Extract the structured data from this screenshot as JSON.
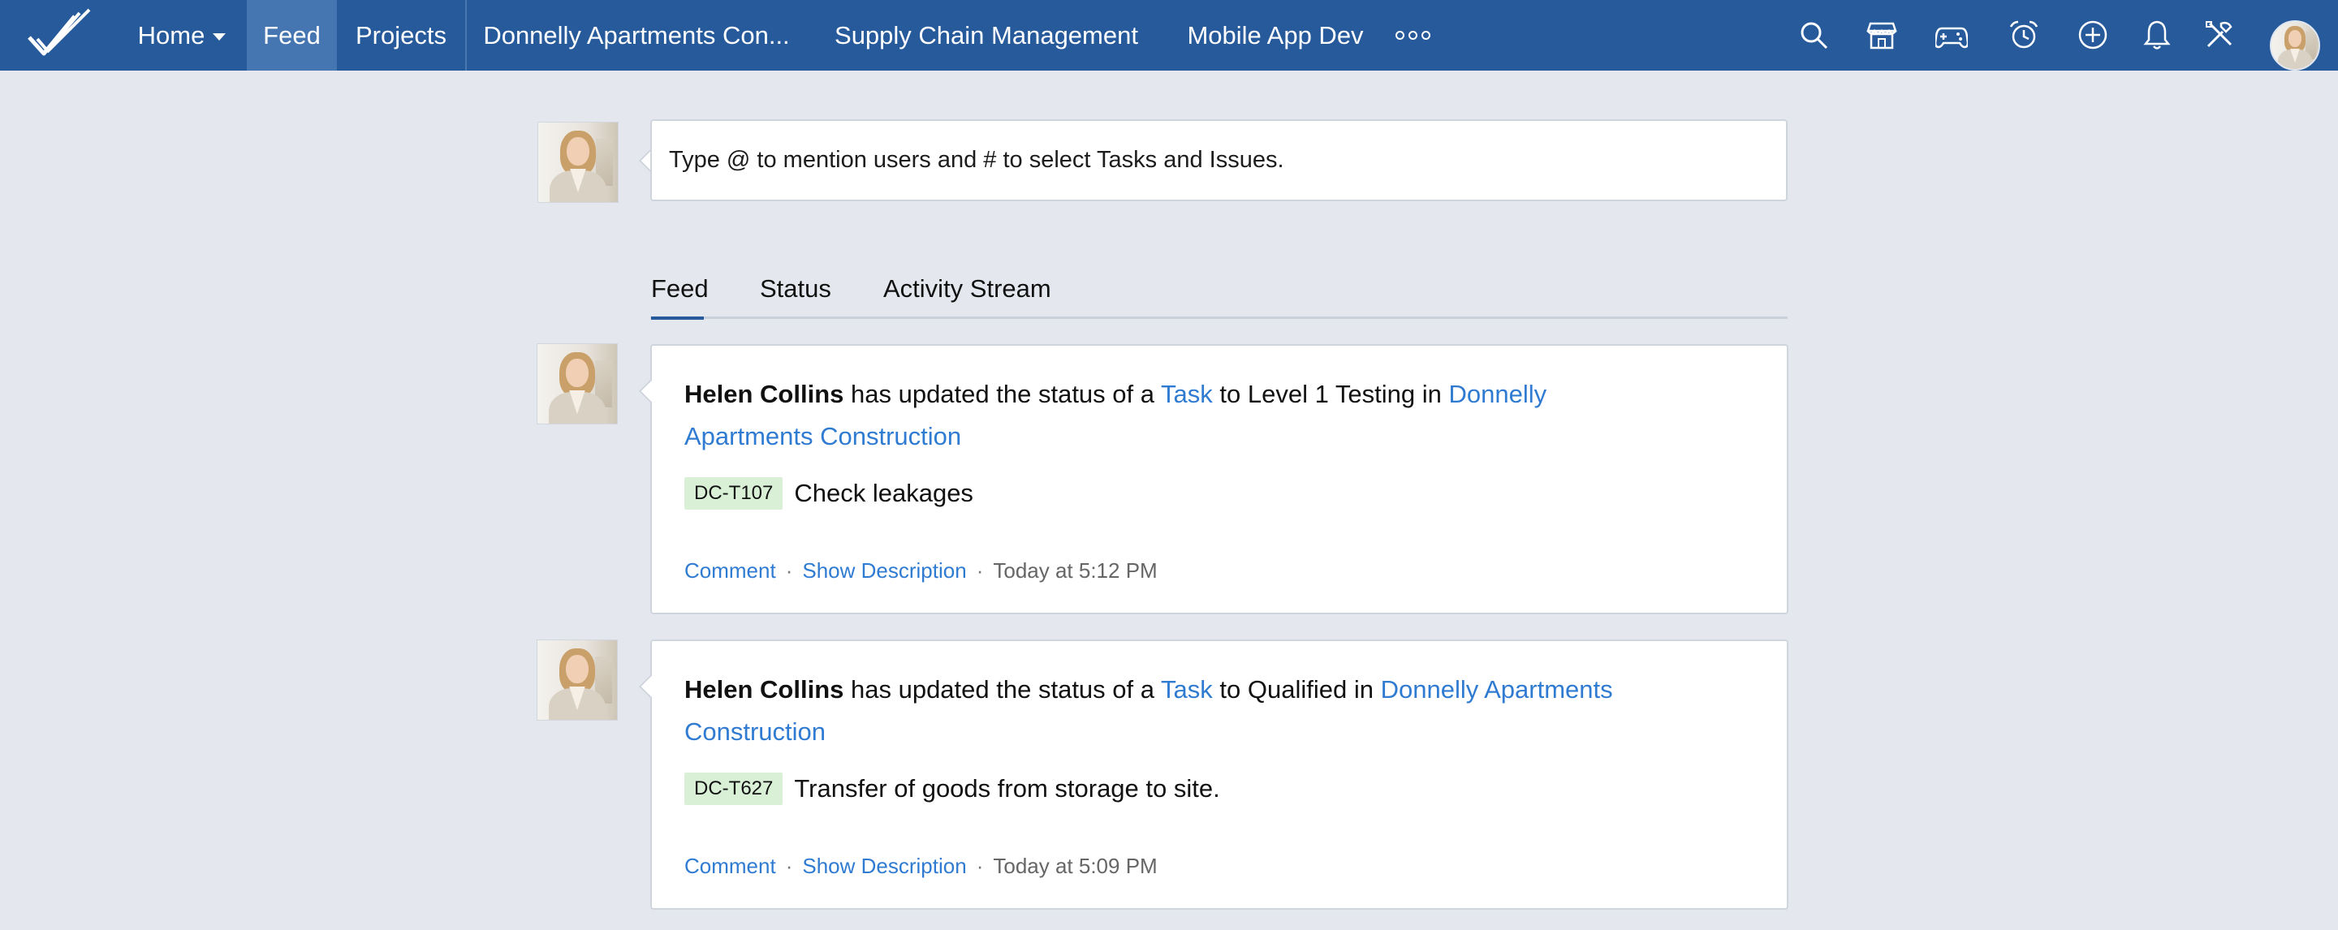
{
  "nav": {
    "home": "Home",
    "feed": "Feed",
    "projects": "Projects",
    "project1": "Donnelly Apartments Con...",
    "project2": "Supply Chain Management",
    "project3": "Mobile App Dev",
    "icons": [
      "search-icon",
      "store-icon",
      "gamepad-icon",
      "alarm-clock-icon",
      "add-circle-icon",
      "bell-icon",
      "tools-icon"
    ]
  },
  "composer": {
    "placeholder": "Type @ to mention users and # to select Tasks and Issues."
  },
  "tabs": [
    {
      "label": "Feed",
      "active": true
    },
    {
      "label": "Status",
      "active": false
    },
    {
      "label": "Activity Stream",
      "active": false
    }
  ],
  "feed": [
    {
      "author": "Helen Collins",
      "text1": " has updated the status of a ",
      "entity": "Task",
      "text2": " to Level 1 Testing in ",
      "project": "Donnelly Apartments Construction",
      "task_id": "DC-T107",
      "task_title": "Check leakages",
      "comment": "Comment",
      "show_description": "Show Description",
      "time": "Today at 5:12 PM"
    },
    {
      "author": "Helen Collins",
      "text1": " has updated the status of a ",
      "entity": "Task",
      "text2": " to Qualified in ",
      "project": "Donnelly Apartments Construction",
      "task_id": "DC-T627",
      "task_title": "Transfer of goods from storage to site.",
      "comment": "Comment",
      "show_description": "Show Description",
      "time": "Today at 5:09 PM"
    }
  ],
  "separator": "·",
  "colors": {
    "topbar": "#265a9b",
    "active_nav": "#4676b1",
    "link": "#2f7bd2",
    "task_badge": "#d9f0d7",
    "background": "#e4e8ee"
  }
}
